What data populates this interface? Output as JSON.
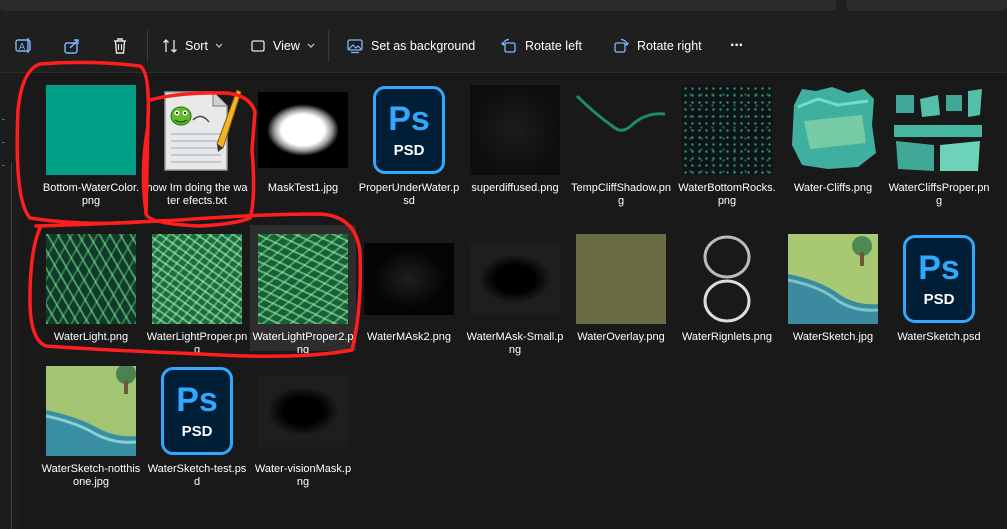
{
  "toolbar": {
    "sort_label": "Sort",
    "view_label": "View",
    "set_background_label": "Set as background",
    "rotate_left_label": "Rotate left",
    "rotate_right_label": "Rotate right",
    "more_label": "···"
  },
  "files": [
    {
      "name": "Bottom-WaterColor.png",
      "icon": "image-thumbnail"
    },
    {
      "name": "how Im doing the water efects.txt",
      "icon": "notepad-icon"
    },
    {
      "name": "MaskTest1.jpg",
      "icon": "image-thumbnail"
    },
    {
      "name": "ProperUnderWater.psd",
      "icon": "psd-icon",
      "ps_text": "Ps",
      "ext_text": "PSD"
    },
    {
      "name": "superdiffused.png",
      "icon": "image-thumbnail"
    },
    {
      "name": "TempCliffShadow.png",
      "icon": "image-thumbnail"
    },
    {
      "name": "WaterBottomRocks.png",
      "icon": "image-thumbnail"
    },
    {
      "name": "Water-Cliffs.png",
      "icon": "image-thumbnail"
    },
    {
      "name": "WaterCliffsProper.png",
      "icon": "image-thumbnail"
    },
    {
      "name": "WaterLight.png",
      "icon": "image-thumbnail"
    },
    {
      "name": "WaterLightProper.png",
      "icon": "image-thumbnail"
    },
    {
      "name": "WaterLightProper2.png",
      "icon": "image-thumbnail",
      "selected": true
    },
    {
      "name": "WaterMAsk2.png",
      "icon": "image-thumbnail"
    },
    {
      "name": "WaterMAsk-Small.png",
      "icon": "image-thumbnail"
    },
    {
      "name": "WaterOverlay.png",
      "icon": "image-thumbnail"
    },
    {
      "name": "WaterRignlets.png",
      "icon": "image-thumbnail"
    },
    {
      "name": "WaterSketch.jpg",
      "icon": "image-thumbnail"
    },
    {
      "name": "WaterSketch.psd",
      "icon": "psd-icon",
      "ps_text": "Ps",
      "ext_text": "PSD"
    },
    {
      "name": "WaterSketch-notthis one.jpg",
      "icon": "image-thumbnail"
    },
    {
      "name": "WaterSketch-test.psd",
      "icon": "psd-icon",
      "ps_text": "Ps",
      "ext_text": "PSD"
    },
    {
      "name": "Water-visionMask.png",
      "icon": "image-thumbnail"
    }
  ],
  "colors": {
    "accent": "#31a8ff",
    "annotation": "#ff1e1e",
    "selection": "#2d2d2d",
    "background": "#191919",
    "water_color": "#00a086"
  }
}
